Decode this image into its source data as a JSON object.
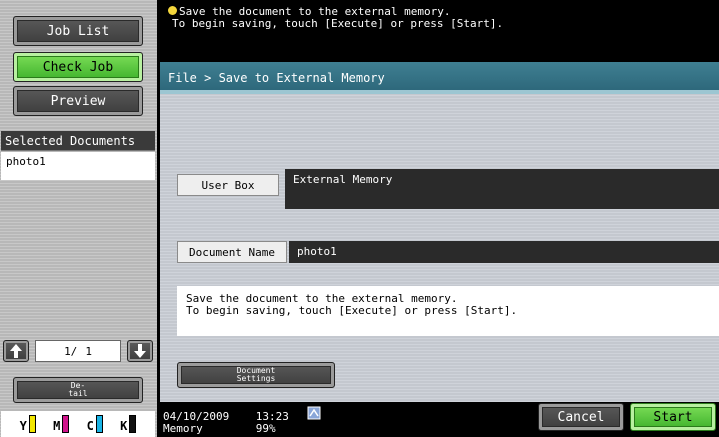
{
  "left_panel": {
    "job_list": "Job List",
    "check_job": "Check Job",
    "preview": "Preview",
    "selected_documents_title": "Selected Documents",
    "selected_documents": [
      "photo1"
    ],
    "page_current": "1/",
    "page_total": "1",
    "detail_line1": "De-",
    "detail_line2": "tail",
    "toner": [
      {
        "label": "Y",
        "color": "#f2e600"
      },
      {
        "label": "M",
        "color": "#d0148c"
      },
      {
        "label": "C",
        "color": "#19b4e6"
      },
      {
        "label": "K",
        "color": "#111111"
      }
    ]
  },
  "message": {
    "line1": "Save the document to the external memory.",
    "line2": "To begin saving, touch [Execute] or press [Start]."
  },
  "main": {
    "breadcrumb": "File > Save to External Memory",
    "user_box_label": "User Box",
    "user_box_value": "External Memory",
    "document_name_label": "Document Name",
    "document_name_value": "photo1",
    "info_line1": "Save the document to the external memory.",
    "info_line2": "To begin saving, touch [Execute] or press [Start].",
    "document_settings_line1": "Document",
    "document_settings_line2": "Settings"
  },
  "status": {
    "date": "04/10/2009",
    "time": "13:23",
    "memory_label": "Memory",
    "memory_value": "99%"
  },
  "actions": {
    "cancel": "Cancel",
    "start": "Start"
  },
  "colors": {
    "accent_green": "#3cb02a",
    "title_bar": "#2b6578"
  }
}
